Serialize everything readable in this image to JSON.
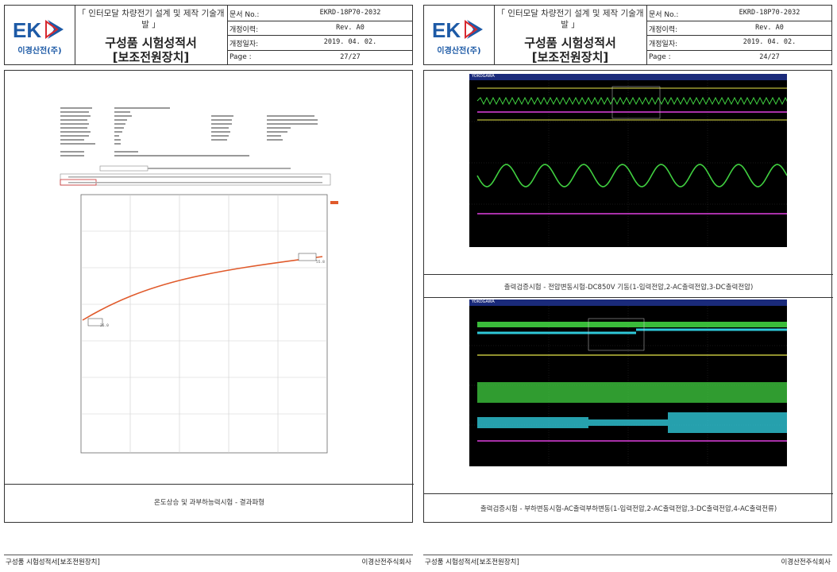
{
  "left_page": {
    "logo": {
      "mark": "EK",
      "company": "이경산전(주)"
    },
    "header": {
      "project_title": "「 인터모달 차량전기 설계 및 제작 기술개발 」",
      "doc_title_line1": "구성품 시험성적서",
      "doc_title_line2": "[보조전원장치]",
      "meta": [
        {
          "key": "문서 No.:",
          "value": "EKRD-18P70-2032"
        },
        {
          "key": "개정이력:",
          "value": "Rev. A0"
        },
        {
          "key": "개정일자:",
          "value": "2019. 04. 02."
        },
        {
          "key": "Page :",
          "value": "27/27"
        }
      ]
    },
    "caption": "온도상승 및 과부하능력시험 - 결과파형",
    "footer_left": "구성품 시험성적서[보조전원장치]",
    "footer_right": "이경산전주식회사",
    "chart_markers": [
      "26.0",
      "55.8"
    ]
  },
  "right_page": {
    "logo": {
      "mark": "EK",
      "company": "이경산전(주)"
    },
    "header": {
      "project_title": "「 인터모달 차량전기 설계 및 제작 기술개발 」",
      "doc_title_line1": "구성품 시험성적서",
      "doc_title_line2": "[보조전원장치]",
      "meta": [
        {
          "key": "문서 No.:",
          "value": "EKRD-18P70-2032"
        },
        {
          "key": "개정이력:",
          "value": "Rev. A0"
        },
        {
          "key": "개정일자:",
          "value": "2019. 04. 02."
        },
        {
          "key": "Page :",
          "value": "24/27"
        }
      ]
    },
    "caption_top": "출력검증시험 - 전압변동시험-DC850V 기동(1-입력전압,2-AC출력전압,3-DC출력전압)",
    "caption_bottom": "출력검증시험 - 부하변동시험-AC출력부하변동(1-입력전압,2-AC출력전압,3-DC출력전압,4-AC출력전류)",
    "scope_brand": "YOKOGAWA",
    "footer_left": "구성품 시험성적서[보조전원장치]",
    "footer_right": "이경산전주식회사"
  },
  "colors": {
    "logo_blue": "#1d5aa6",
    "logo_red": "#d7282f",
    "trace_orange": "#e05a2b",
    "trace_yellow": "#e8e84a",
    "trace_green": "#40d040",
    "trace_cyan": "#2fc8d8",
    "trace_magenta": "#e040e0"
  }
}
